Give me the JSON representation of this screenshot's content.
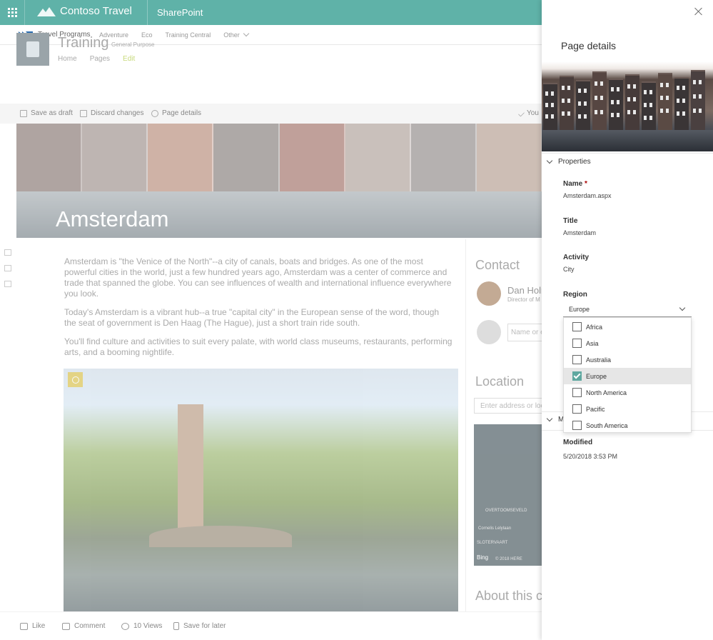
{
  "suite": {
    "brand": "Contoso Travel",
    "app": "SharePoint",
    "accent": "#5fb2a8"
  },
  "hub": {
    "title": "Travel Programs",
    "links": [
      "Adventure",
      "Eco",
      "Training Central",
      "Other"
    ]
  },
  "site": {
    "title": "Training",
    "subtitle": "General Purpose",
    "nav": [
      "Home",
      "Pages",
      "Edit"
    ]
  },
  "commands": {
    "save_draft": "Save as draft",
    "discard": "Discard changes",
    "page_details": "Page details",
    "status": "You"
  },
  "hero": {
    "title": "Amsterdam"
  },
  "article": {
    "paragraphs": [
      "Amsterdam is \"the Venice of the North\"--a city of canals, boats and bridges. As one of the most powerful cities in the world, just a few hundred years ago, Amsterdam was a center of commerce and trade that spanned the globe.  You can see influences of wealth and international influence everywhere you look.",
      "Today's Amsterdam is a vibrant hub--a true \"capital city\" in the European sense of the word, though the seat of government is Den Haag (The Hague), just a short train ride south.",
      "You'll find culture and activities to suit every palate, with world class museums, restaurants, performing arts, and a booming nightlife."
    ]
  },
  "right_column": {
    "contact_heading": "Contact",
    "contact_name": "Dan Holm",
    "contact_role": "Director of M",
    "name_placeholder": "Name or e",
    "location_heading": "Location",
    "address_placeholder": "Enter address or loc",
    "about_heading": "About this co",
    "map_labels": [
      "OVERTOOMSEVELD",
      "Cornelis Lelylaan",
      "SLOTERVAART",
      "Bing",
      "© 2018 HERE"
    ]
  },
  "bottom": {
    "like": "Like",
    "comment": "Comment",
    "views": "10 Views",
    "save_later": "Save for later"
  },
  "panel": {
    "title": "Page details",
    "properties_heading": "Properties",
    "name_label": "Name",
    "required_mark": "*",
    "name_value": "Amsterdam.aspx",
    "title_label": "Title",
    "title_value": "Amsterdam",
    "activity_label": "Activity",
    "activity_value": "City",
    "region_label": "Region",
    "region_value": "Europe",
    "region_options": [
      {
        "label": "Africa",
        "checked": false
      },
      {
        "label": "Asia",
        "checked": false
      },
      {
        "label": "Australia",
        "checked": false
      },
      {
        "label": "Europe",
        "checked": true
      },
      {
        "label": "North America",
        "checked": false
      },
      {
        "label": "Pacific",
        "checked": false
      },
      {
        "label": "South America",
        "checked": false
      }
    ],
    "modified_section_heading": "Mo",
    "modified_label": "Modified",
    "modified_value": "5/20/2018 3:53 PM"
  }
}
